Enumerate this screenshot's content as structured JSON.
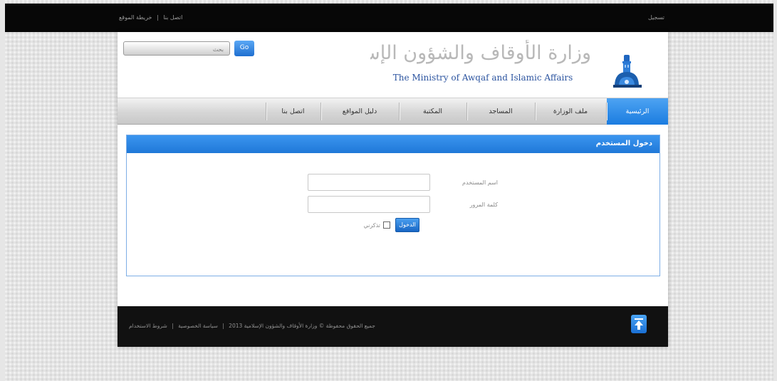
{
  "topbar": {
    "links": [
      "اتصل بنا",
      "|",
      "خريطة الموقع"
    ],
    "right_text": "تسجيل"
  },
  "header": {
    "search_placeholder": "بحث",
    "search_button": "Go",
    "logo_arabic": "وزارة الأوقاف والشؤون الإسلامية",
    "logo_english": "The Ministry of Awqaf and Islamic Affairs"
  },
  "nav": {
    "items": [
      "الرئيسية",
      "ملف الوزارة",
      "المساجد",
      "المكتبة",
      "دليل المواقع",
      "اتصل بنا"
    ]
  },
  "login": {
    "title": "دخول المستخدم",
    "username_label": "اسم المستخدم",
    "password_label": "كلمة المرور",
    "remember_label": "تذكرني",
    "submit_label": "الدخول"
  },
  "footer": {
    "copyright": "جميع الحقوق محفوظة © وزارة الأوقاف والشؤون الإسلامية 2013",
    "links": [
      "سياسة الخصوصية",
      "شروط الاستخدام"
    ],
    "separator": "|"
  },
  "colors": {
    "accent": "#1f78d8",
    "topbar": "#070707",
    "footer": "#111111"
  }
}
